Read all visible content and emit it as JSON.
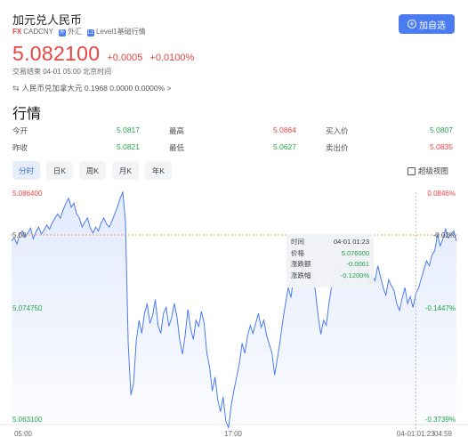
{
  "header": {
    "title": "加元兑人民币",
    "tag_fx": "FX",
    "tag_code": "CADCNY",
    "tag_market": "外汇",
    "tag_market_icon": "外",
    "tag_level": "Level1基础行情",
    "tag_level_icon": "L1",
    "follow_label": "加自选"
  },
  "quote": {
    "price": "5.082100",
    "change": "+0.0005",
    "change_pct": "+0.0100%",
    "status": "交易结束 04-01 05:00 北京时间",
    "reverse": "人民币兑加拿大元 0.1968 0.0000 0.0000% >"
  },
  "market": {
    "title": "行情",
    "stats": [
      {
        "label": "今开",
        "value": "5.0817",
        "color": "green"
      },
      {
        "label": "最高",
        "value": "5.0864",
        "color": "red"
      },
      {
        "label": "买入价",
        "value": "5.0807",
        "color": "green"
      },
      {
        "label": "昨收",
        "value": "5.0821",
        "color": "green"
      },
      {
        "label": "最低",
        "value": "5.0627",
        "color": "green"
      },
      {
        "label": "卖出价",
        "value": "5.0835",
        "color": "red"
      }
    ]
  },
  "tabs": [
    "分时",
    "日K",
    "周K",
    "月K",
    "年K"
  ],
  "active_tab": 0,
  "super_view_label": "超级视图",
  "tooltip": {
    "rows": [
      {
        "label": "时间",
        "value": "04-01 01:23",
        "color": "dark"
      },
      {
        "label": "价格",
        "value": "5.076000",
        "color": "green"
      },
      {
        "label": "涨跌额",
        "value": "-0.0061",
        "color": "green"
      },
      {
        "label": "涨跌幅",
        "value": "-0.1200%",
        "color": "green"
      }
    ]
  },
  "chart_data": {
    "type": "line",
    "y_left_ticks": [
      "5.086400",
      "5.08",
      "5.074750",
      "5.063100"
    ],
    "y_right_ticks": [
      "0.0846%",
      "-0.02%",
      "-0.1447%",
      "-0.3739%"
    ],
    "x_ticks": [
      "05:00",
      "17:00",
      "04-01 01:23",
      "04:59"
    ],
    "ylim": [
      5.0631,
      5.0864
    ],
    "prev_close": 5.0821,
    "crosshair": {
      "time": "04-01 01:23",
      "price": 5.076
    },
    "colors": {
      "line": "#4a7cf0",
      "up": "#e84545",
      "down": "#22a34a",
      "prev_close": "#f0a070"
    },
    "series": [
      {
        "values": [
          5.0815,
          5.0818,
          5.0812,
          5.0822,
          5.0825,
          5.0819,
          5.0823,
          5.0828,
          5.0817,
          5.0824,
          5.0829,
          5.0822,
          5.0826,
          5.0831,
          5.0827,
          5.0833,
          5.0838,
          5.0842,
          5.0838,
          5.0846,
          5.0853,
          5.0858,
          5.0849,
          5.0853,
          5.0842,
          5.0838,
          5.0829,
          5.0834,
          5.0838,
          5.0828,
          5.0823,
          5.0829,
          5.0825,
          5.0833,
          5.0838,
          5.0832,
          5.0829,
          5.0835,
          5.0842,
          5.0849,
          5.0858,
          5.0864,
          5.0835,
          5.0712,
          5.066,
          5.0672,
          5.0715,
          5.0735,
          5.0722,
          5.0742,
          5.0752,
          5.0732,
          5.074,
          5.0756,
          5.073,
          5.0722,
          5.0742,
          5.0748,
          5.0729,
          5.0738,
          5.0752,
          5.0738,
          5.0715,
          5.0701,
          5.072,
          5.0746,
          5.0727,
          5.0716,
          5.0735,
          5.0729,
          5.0744,
          5.0732,
          5.0702,
          5.0688,
          5.0664,
          5.0678,
          5.0655,
          5.0643,
          5.0658,
          5.0633,
          5.0627,
          5.065,
          5.0665,
          5.0678,
          5.0692,
          5.0712,
          5.0702,
          5.0719,
          5.073,
          5.0722,
          5.0732,
          5.0742,
          5.0728,
          5.0735,
          5.072,
          5.0711,
          5.0702,
          5.068,
          5.0697,
          5.0714,
          5.0735,
          5.0752,
          5.0768,
          5.0758,
          5.0779,
          5.0796,
          5.0785,
          5.0802,
          5.079,
          5.0779,
          5.0796,
          5.0782,
          5.0764,
          5.074,
          5.0721,
          5.0735,
          5.073,
          5.0752,
          5.077,
          5.0781,
          5.0795,
          5.0788,
          5.0772,
          5.0778,
          5.0769,
          5.0782,
          5.0794,
          5.0802,
          5.0788,
          5.0775,
          5.078,
          5.0784,
          5.077,
          5.078,
          5.0775,
          5.079,
          5.0779,
          5.0768,
          5.076,
          5.0776,
          5.077,
          5.0765,
          5.0752,
          5.0745,
          5.0757,
          5.0768,
          5.0752,
          5.0759,
          5.0748,
          5.0762,
          5.0767,
          5.0777,
          5.0786,
          5.0795,
          5.079,
          5.0801,
          5.0805,
          5.0822,
          5.081,
          5.0817,
          5.0827,
          5.0818,
          5.0822,
          5.0825,
          5.0815
        ]
      }
    ]
  }
}
